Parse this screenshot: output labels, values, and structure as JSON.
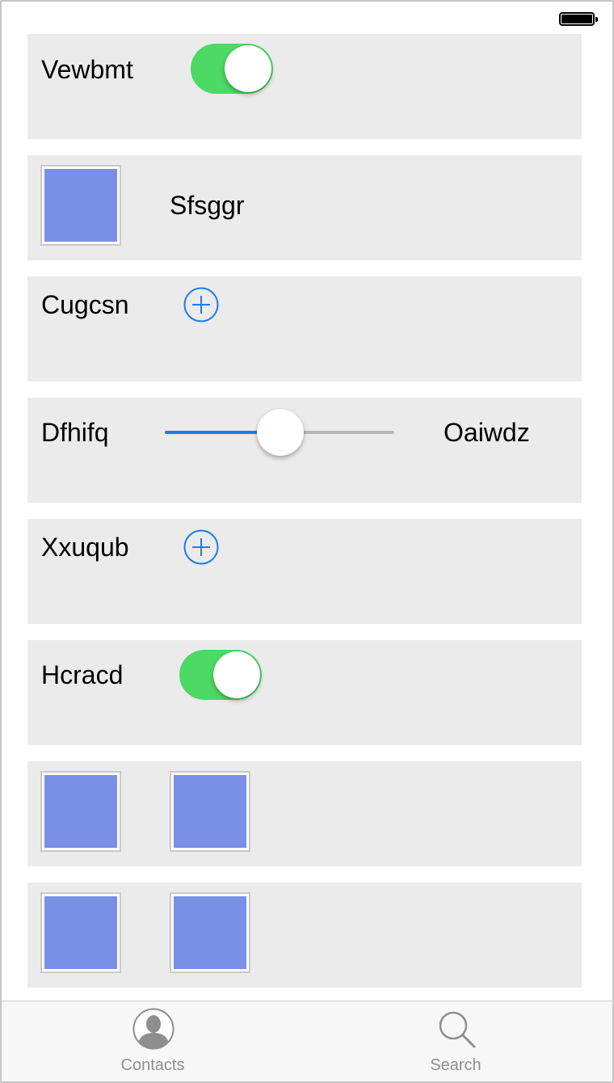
{
  "status_bar": {
    "battery_icon": "battery-full-icon"
  },
  "rows": {
    "r1": {
      "label": "Vewbmt",
      "switch_on": true
    },
    "r2": {
      "label": "Sfsggr",
      "image_color": "#7990e6"
    },
    "r3": {
      "label": "Cugcsn",
      "button_icon": "add-circle-icon"
    },
    "r4": {
      "label_left": "Dfhifq",
      "label_right": "Oaiwdz",
      "slider_value": 0.5
    },
    "r5": {
      "label": "Xxuqub",
      "button_icon": "add-circle-icon"
    },
    "r6": {
      "label": "Hcracd",
      "switch_on": true
    },
    "r7": {
      "image_count": 2
    },
    "r8": {
      "image_count": 2
    }
  },
  "tabbar": {
    "items": [
      {
        "label": "Contacts",
        "icon": "contacts-icon"
      },
      {
        "label": "Search",
        "icon": "search-icon"
      }
    ]
  },
  "colors": {
    "switch_on": "#4cd964",
    "tint": "#1a7df0",
    "row_background": "#ebebeb",
    "image_fill": "#7990e6"
  }
}
